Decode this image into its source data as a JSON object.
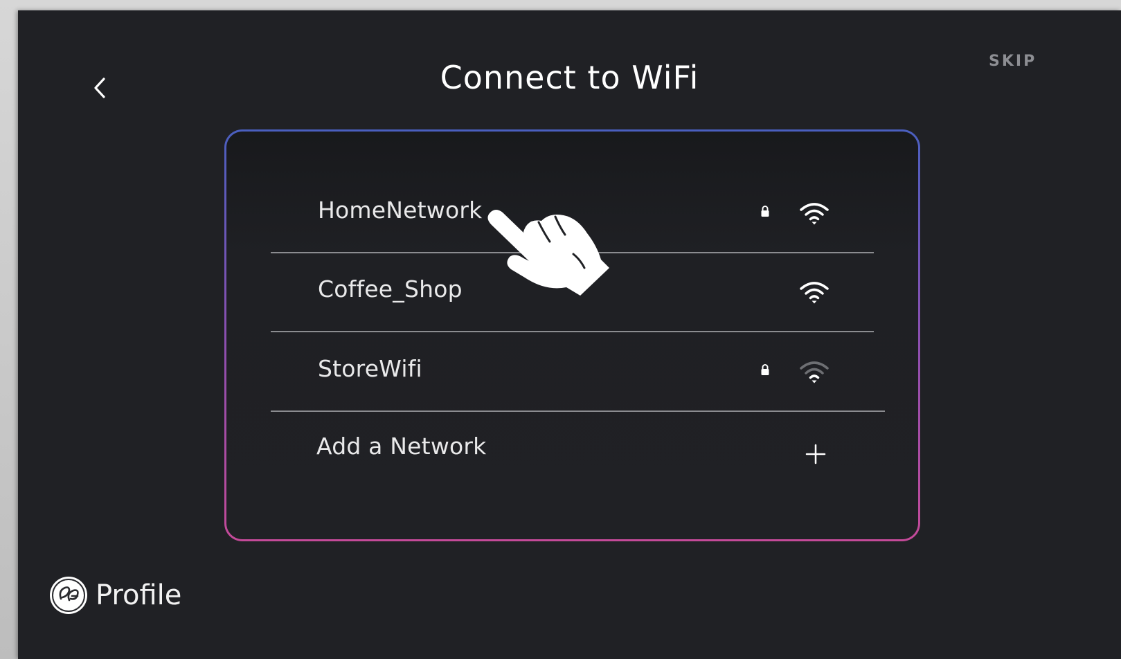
{
  "header": {
    "back_icon": "chevron-left-icon",
    "title": "Connect to WiFi",
    "skip_label": "SKIP"
  },
  "networks": [
    {
      "name": "HomeNetwork",
      "secured": true,
      "signal": "full",
      "icons": [
        "lock-icon",
        "wifi-icon"
      ]
    },
    {
      "name": "Coffee_Shop",
      "secured": false,
      "signal": "full",
      "icons": [
        "wifi-icon"
      ]
    },
    {
      "name": "StoreWifi",
      "secured": true,
      "signal": "weak",
      "icons": [
        "lock-icon",
        "wifi-icon"
      ]
    }
  ],
  "add_network": {
    "label": "Add a Network",
    "icon": "plus-icon"
  },
  "branding": {
    "logo_icon": "ge-monogram-icon",
    "text": "Profile"
  },
  "colors": {
    "background": "#202125",
    "card_border_top": "#4a5fbf",
    "card_border_bottom": "#c44a99",
    "text": "#e9e9ea",
    "skip": "#8d8e93",
    "weak_signal": "#6e6f73"
  }
}
